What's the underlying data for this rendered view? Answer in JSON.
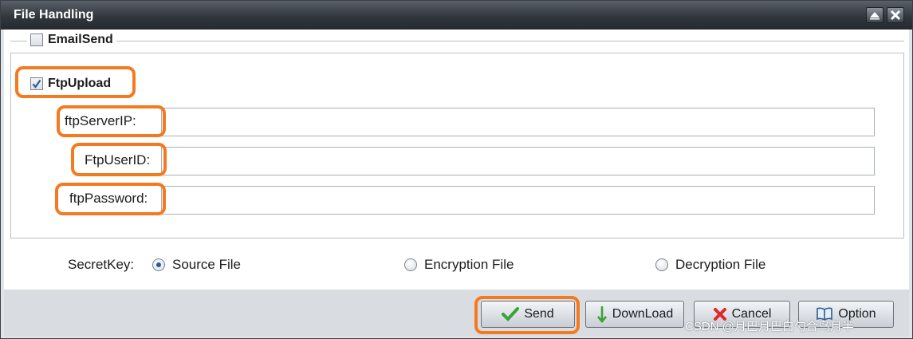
{
  "window": {
    "title": "File Handling"
  },
  "email_section": {
    "label": "EmailSend",
    "checked": false
  },
  "ftp_section": {
    "label": "FtpUpload",
    "checked": true,
    "fields": {
      "server_ip": {
        "label": "ftpServerIP:",
        "value": ""
      },
      "user_id": {
        "label": "FtpUserID:",
        "value": ""
      },
      "password": {
        "label": "ftpPassword:",
        "value": ""
      }
    }
  },
  "secret_key": {
    "label": "SecretKey:",
    "options": [
      {
        "label": "Source File",
        "selected": true
      },
      {
        "label": "Encryption File",
        "selected": false
      },
      {
        "label": "Decryption File",
        "selected": false
      }
    ]
  },
  "buttons": {
    "send": "Send",
    "download": "DownLoad",
    "cancel": "Cancel",
    "option": "Option"
  },
  "watermark": "CSDN @月巴月巴白勺合鸟月半",
  "colors": {
    "highlight": "#f47a1f",
    "titlebar": "#32373e",
    "check": "#2b5c92"
  },
  "icons": {
    "restore": "restore-icon",
    "close": "close-icon",
    "send": "checkmark-icon",
    "download": "arrow-down-icon",
    "cancel": "x-icon",
    "option": "book-icon"
  }
}
